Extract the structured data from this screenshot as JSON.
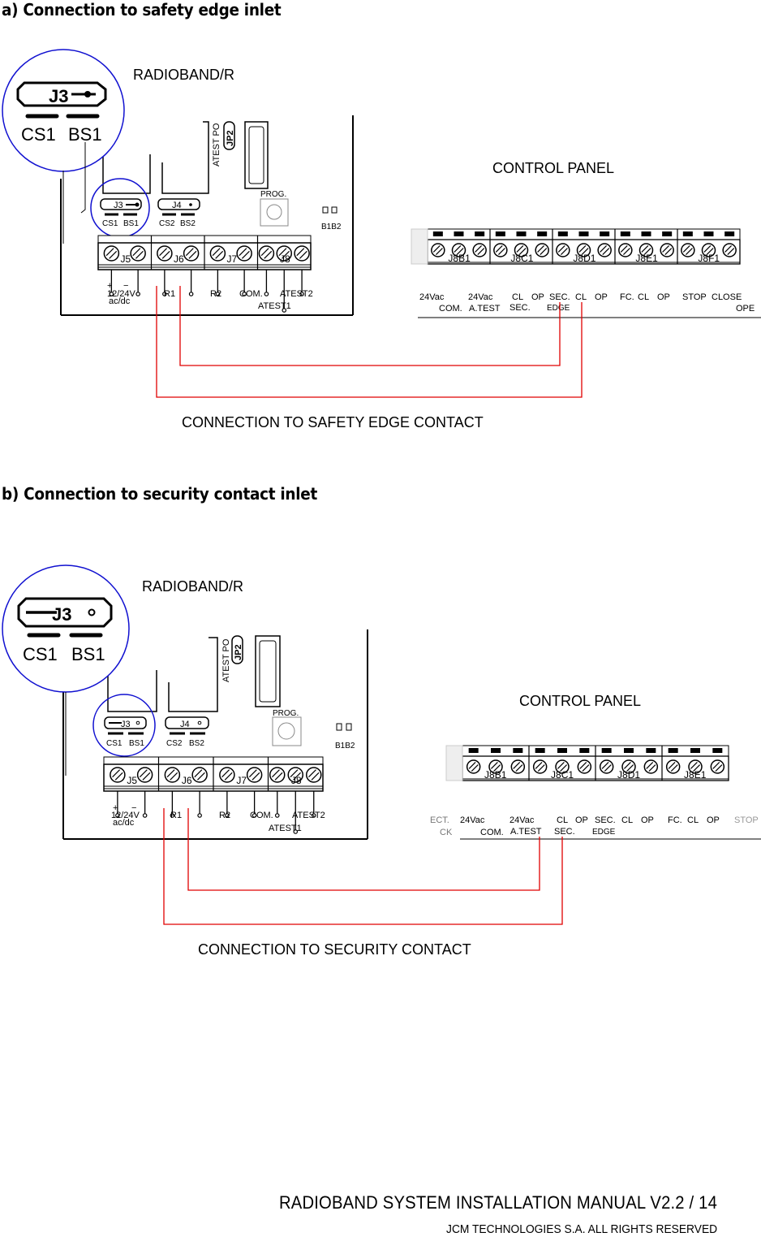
{
  "sections": [
    {
      "heading": "a) Connection to safety edge inlet",
      "receiver": {
        "title": "RADIOBAND/R",
        "jumper_zoom": {
          "jumper": "J3",
          "position": "BS1",
          "pins": [
            "CS1",
            "BS1"
          ]
        },
        "jumpers": [
          {
            "name": "J3",
            "pins": [
              "CS1",
              "BS1"
            ]
          },
          {
            "name": "J4",
            "pins": [
              "CS2",
              "BS2"
            ]
          }
        ],
        "jp2_label": "JP2",
        "atest_po_label": "ATEST PO",
        "prog_label": "PROG.",
        "b1b2_label": "B1B2",
        "terminal_blocks": [
          "J5",
          "J6",
          "J7",
          "J8"
        ],
        "terminal_labels": [
          "12/24V",
          "ac/dc",
          "R1",
          "R2",
          "COM.",
          "ATEST1",
          "ATEST2"
        ],
        "polarity": [
          "+",
          "−"
        ]
      },
      "control_panel": {
        "title": "CONTROL PANEL",
        "blocks": [
          "J8B1",
          "J8C1",
          "J8D1",
          "J8E1",
          "J8F1"
        ],
        "labels_row1": [
          "24Vac",
          "24Vac",
          "CL",
          "OP",
          "SEC.",
          "CL",
          "OP",
          "FC.",
          "CL",
          "OP",
          "STOP",
          "CLOSE"
        ],
        "labels_row2": [
          "COM.",
          "A.TEST",
          "SEC.",
          "EDGE",
          "OPE"
        ]
      },
      "caption": "CONNECTION TO SAFETY EDGE CONTACT",
      "wire_color": "#e00000",
      "highlight_color": "#1010d0"
    },
    {
      "heading": "b) Connection to security contact inlet",
      "receiver": {
        "title": "RADIOBAND/R",
        "jumper_zoom": {
          "jumper": "J3",
          "position": "CS1",
          "pins": [
            "CS1",
            "BS1"
          ]
        },
        "jumpers": [
          {
            "name": "J3",
            "pins": [
              "CS1",
              "BS1"
            ]
          },
          {
            "name": "J4",
            "pins": [
              "CS2",
              "BS2"
            ]
          }
        ],
        "jp2_label": "JP2",
        "atest_po_label": "ATEST PO",
        "prog_label": "PROG.",
        "b1b2_label": "B1B2",
        "terminal_blocks": [
          "J5",
          "J6",
          "J7",
          "J8"
        ],
        "terminal_labels": [
          "12/24V",
          "ac/dc",
          "R1",
          "R2",
          "COM.",
          "ATEST1",
          "ATEST2"
        ],
        "polarity": [
          "+",
          "−"
        ]
      },
      "control_panel": {
        "title": "CONTROL PANEL",
        "blocks": [
          "J8B1",
          "J8C1",
          "J8D1",
          "J8E1"
        ],
        "labels_row1": [
          "ECT.",
          "24Vac",
          "24Vac",
          "CL",
          "OP",
          "SEC.",
          "CL",
          "OP",
          "FC.",
          "CL",
          "OP",
          "STOP"
        ],
        "labels_row2": [
          "CK",
          "COM.",
          "A.TEST",
          "SEC.",
          "EDGE"
        ]
      },
      "caption": "CONNECTION TO SECURITY CONTACT",
      "wire_color": "#e00000",
      "highlight_color": "#1010d0"
    }
  ],
  "footer": {
    "title": "RADIOBAND SYSTEM INSTALLATION MANUAL V2.2 / 14",
    "copyright": "JCM TECHNOLOGIES S.A. ALL RIGHTS RESERVED"
  }
}
